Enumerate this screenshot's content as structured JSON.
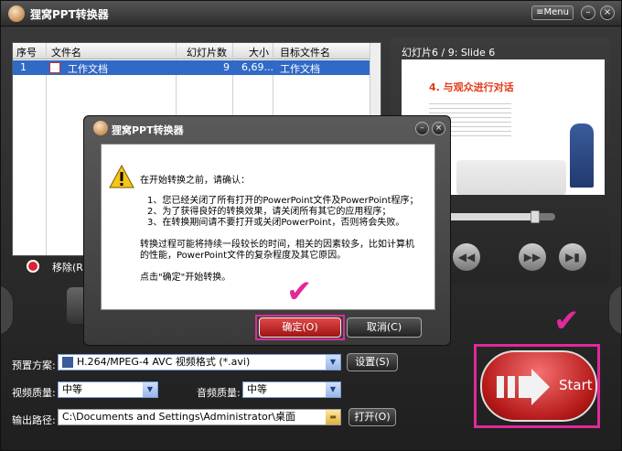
{
  "app": {
    "title": "狸窝PPT转换器",
    "menu_label": "Menu",
    "minimize_glyph": "–",
    "close_glyph": "×"
  },
  "grid": {
    "columns": [
      "序号",
      "文件名",
      "幻灯片数",
      "大小",
      "目标文件名"
    ],
    "rows": [
      {
        "index": "1",
        "filename": "工作文档",
        "slides": "9",
        "size": "6,69...",
        "target": "工作文档"
      }
    ]
  },
  "remove_label": "移除(R)",
  "preview": {
    "label": "幻灯片6 / 9: Slide 6",
    "slide_heading": "4. 与观众进行对话",
    "progress": 0.85,
    "controls": [
      "previous-icon",
      "rewind-icon",
      "fast-forward-icon",
      "next-icon"
    ]
  },
  "settings": {
    "preset_label": "预置方案:",
    "preset_value": "H.264/MPEG-4 AVC 视频格式 (*.avi)",
    "settings_button": "设置(S)",
    "video_quality_label": "视频质量:",
    "video_quality_value": "中等",
    "audio_quality_label": "音频质量:",
    "audio_quality_value": "中等",
    "output_label": "输出路径:",
    "output_value": "C:\\Documents and Settings\\Administrator\\桌面",
    "open_button": "打开(O)"
  },
  "start_label": "Start",
  "dialog": {
    "title": "狸窝PPT转换器",
    "intro": "在开始转换之前，请确认：",
    "items": [
      "1、您已经关闭了所有打开的PowerPoint文件及PowerPoint程序；",
      "2、为了获得良好的转换效果，请关闭所有其它的应用程序；",
      "3、在转换期间请不要打开或关闭PowerPoint，否则将会失败。"
    ],
    "note_line1": "转换过程可能将持续一段较长的时间，相关的因素较多，比如计算机",
    "note_line2": "的性能，PowerPoint文件的复杂程度及其它原因。",
    "prompt": "点击\"确定\"开始转换。",
    "ok_button": "确定(O)",
    "cancel_button": "取消(C)"
  },
  "colors": {
    "accent_highlight": "#e0299a",
    "selection": "#3169c6",
    "start_red": "#c01e1e"
  }
}
